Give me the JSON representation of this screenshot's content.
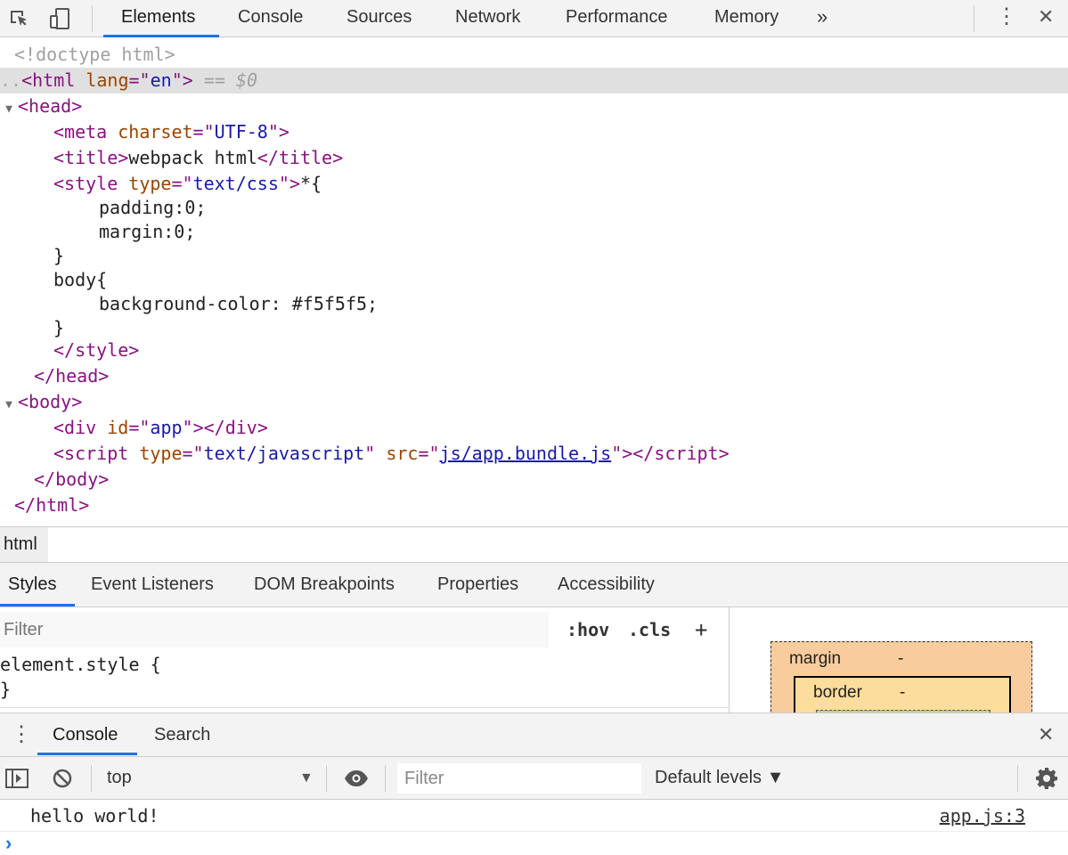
{
  "toolbar": {
    "tabs": [
      "Elements",
      "Console",
      "Sources",
      "Network",
      "Performance",
      "Memory"
    ],
    "more_label": "»",
    "menu_glyph": "⋮",
    "close_glyph": "✕"
  },
  "dom": {
    "doctype": "<!doctype html>",
    "html_open": "<html lang=\"en\">",
    "selected_suffix": "== $0",
    "meta": "<meta charset=\"UTF-8\">",
    "title_text": "webpack html",
    "style_attr_val": "text/css",
    "css_lines": [
      "padding:0;",
      "margin:0;",
      "}",
      "body{",
      "background-color: #f5f5f5;",
      "}"
    ],
    "div_id": "app",
    "script_type": "text/javascript",
    "script_src": "js/app.bundle.js"
  },
  "breadcrumb": {
    "item": "html"
  },
  "sidebar_tabs": [
    "Styles",
    "Event Listeners",
    "DOM Breakpoints",
    "Properties",
    "Accessibility"
  ],
  "styles": {
    "filter_placeholder": "Filter",
    "hov": ":hov",
    "cls": ".cls",
    "plus": "+",
    "rule_selector": "element.style {",
    "rule_close": "}"
  },
  "box_model": {
    "margin_label": "margin",
    "margin_value": "-",
    "border_label": "border",
    "border_value": "-"
  },
  "drawer": {
    "tabs": [
      "Console",
      "Search"
    ],
    "context": "top",
    "filter_placeholder": "Filter",
    "levels": "Default levels ▼",
    "message": "hello world!",
    "source": "app.js:3",
    "prompt": "›"
  }
}
